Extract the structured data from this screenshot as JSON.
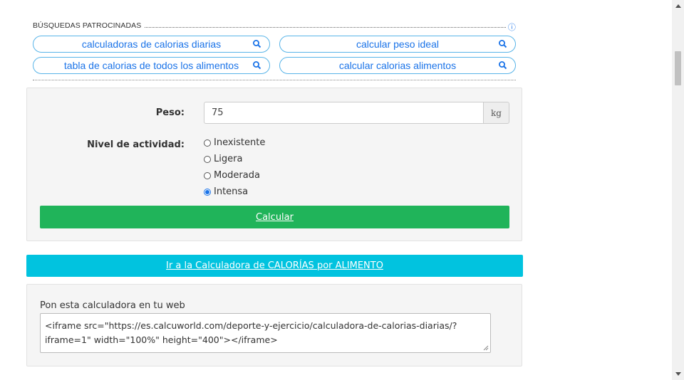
{
  "sponsored": {
    "header": "BÚSQUEDAS PATROCINADAS",
    "info_icon": "info-icon",
    "items": [
      {
        "label": "calculadoras de calorias diarias",
        "icon": "search-icon"
      },
      {
        "label": "calcular peso ideal",
        "icon": "search-icon"
      },
      {
        "label": "tabla de calorias de todos los alimentos",
        "icon": "search-icon"
      },
      {
        "label": "calcular calorias alimentos",
        "icon": "search-icon"
      }
    ]
  },
  "form": {
    "weight_label": "Peso:",
    "weight_value": "75",
    "weight_unit": "kg",
    "activity_label": "Nivel de actividad:",
    "activity_options": [
      "Inexistente",
      "Ligera",
      "Moderada",
      "Intensa"
    ],
    "activity_selected": "Intensa",
    "calculate_label": "Calcular"
  },
  "link_bar": {
    "label": "Ir a la Calculadora de CALORÍAS por ALIMENTO"
  },
  "embed": {
    "title": "Pon esta calculadora en tu web",
    "code": "<iframe src=\"https://es.calcuworld.com/deporte-y-ejercicio/calculadora-de-calorias-diarias/?iframe=1\" width=\"100%\" height=\"400\"></iframe>"
  },
  "colors": {
    "accent_blue": "#1a73e8",
    "green": "#20b45a",
    "cyan": "#01c3df"
  }
}
